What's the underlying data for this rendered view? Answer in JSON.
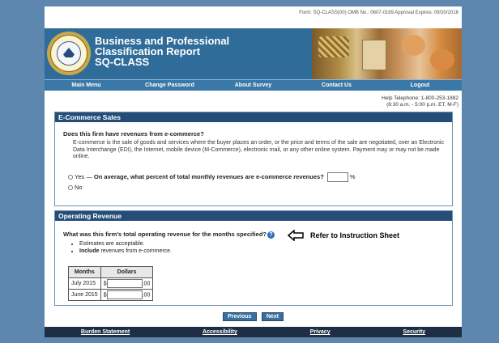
{
  "form_id": "Form: SQ-CLASS(00) OMB No.: 0607-0189 Approval Expires: 09/30/2016",
  "header": {
    "title_line1": "Business and Professional",
    "title_line2": "Classification Report",
    "title_line3": "SQ-CLASS"
  },
  "nav": [
    "Main Menu",
    "Change Password",
    "About Survey",
    "Contact Us",
    "Logout"
  ],
  "help": {
    "line1": "Help Telephone: 1-800-253-1882",
    "line2": "(8:30 a.m. - 5:00 p.m. ET, M-F)"
  },
  "ecommerce": {
    "heading": "E-Commerce Sales",
    "question": "Does this firm have revenues from e-commerce?",
    "description": "E-commerce is the sale of goods and services where the buyer places an order, or the price and terms of the sale are negotiated, over an Electronic Data Interchange (EDI), the Internet, mobile device (M-Commerce), electronic mail, or any other online system. Payment may or may not be made online.",
    "yes_label": "Yes —",
    "yes_question": "On average, what percent of total monthly revenues are e-commerce revenues?",
    "percent_sign": "%",
    "no_label": "No"
  },
  "revenue": {
    "heading": "Operating Revenue",
    "question": "What was this firm's total operating revenue for the months specified?",
    "help_icon": "?",
    "refer_text": "Refer to Instruction Sheet",
    "bullet1": "Estimates are acceptable.",
    "bullet2_bold": "Include",
    "bullet2_rest": " revenues from e-commerce.",
    "col_months": "Months",
    "col_dollars": "Dollars",
    "rows": [
      {
        "month": "July 2015",
        "currency": "$",
        "cents": ".00"
      },
      {
        "month": "June 2015",
        "currency": "$",
        "cents": ".00"
      }
    ]
  },
  "buttons": {
    "previous": "Previous",
    "next": "Next"
  },
  "footer": [
    "Burden Statement",
    "Accessibility",
    "Privacy",
    "Security"
  ]
}
